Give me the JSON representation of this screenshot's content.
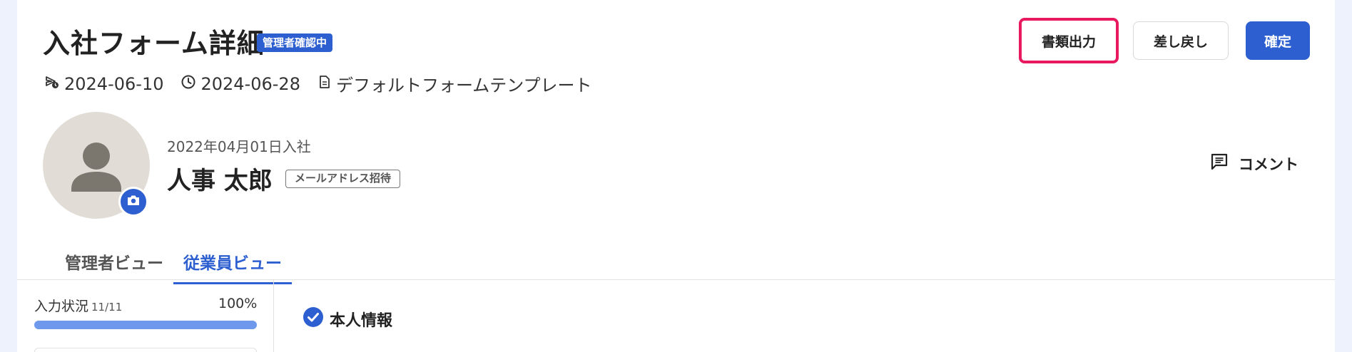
{
  "header": {
    "title": "入社フォーム詳細",
    "status_badge": "管理者確認中",
    "buttons": {
      "export": "書類出力",
      "return": "差し戻し",
      "confirm": "確定"
    },
    "meta": {
      "sent_date": "2024-06-10",
      "due_date": "2024-06-28",
      "template": "デフォルトフォームテンプレート"
    }
  },
  "employee": {
    "join_date": "2022年04月01日入社",
    "name": "人事 太郎",
    "invite_badge": "メールアドレス招待"
  },
  "comment_label": "コメント",
  "tabs": [
    {
      "label": "管理者ビュー",
      "active": false
    },
    {
      "label": "従業員ビュー",
      "active": true
    }
  ],
  "progress": {
    "label": "入力状況",
    "count": "11/11",
    "percent_text": "100%",
    "fraction": 1.0
  },
  "section": {
    "title": "本人情報"
  },
  "colors": {
    "accent": "#2d5fd0",
    "highlight": "#e8195f",
    "progress": "#6f99ec"
  },
  "icons": [
    "send-clock-icon",
    "clock-icon",
    "document-icon",
    "person-icon",
    "camera-icon",
    "comment-icon",
    "check-circle-icon"
  ]
}
